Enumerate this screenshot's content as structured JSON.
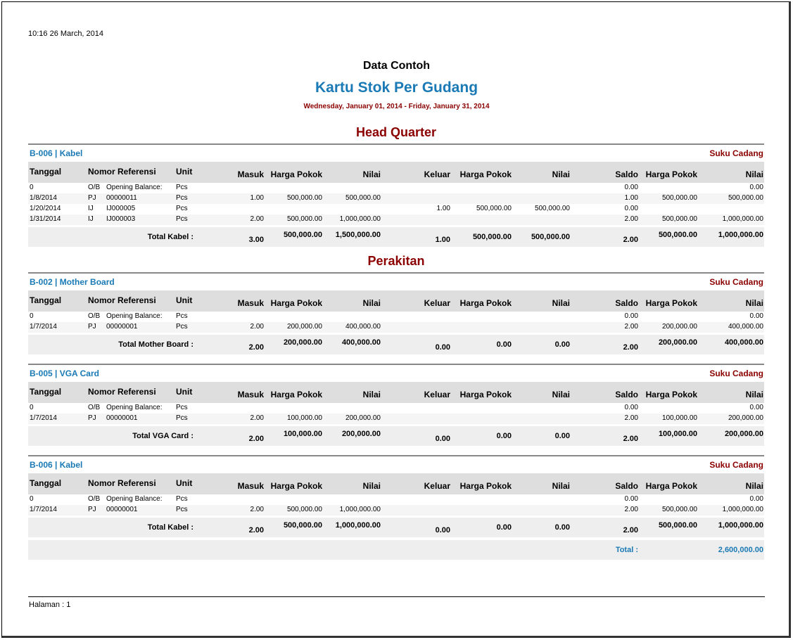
{
  "header": {
    "time": "10:16  26 March, 2014",
    "company": "Data Contoh",
    "title": "Kartu Stok Per Gudang",
    "period": "Wednesday, January 01, 2014 - Friday, January 31, 2014"
  },
  "columns": {
    "tanggal": "Tanggal",
    "nomor_referensi": "Nomor Referensi",
    "unit": "Unit",
    "masuk": "Masuk",
    "harga_pokok_masuk": "Harga Pokok",
    "nilai_masuk": "Nilai",
    "keluar": "Keluar",
    "harga_pokok_keluar": "Harga Pokok",
    "nilai_keluar": "Nilai",
    "saldo": "Saldo",
    "harga_pokok_saldo": "Harga Pokok",
    "nilai_saldo": "Nilai"
  },
  "warehouses": [
    {
      "name": "Head Quarter",
      "groups": [
        {
          "code": "B-006  |  Kabel",
          "category": "Suku Cadang",
          "rows": [
            [
              "0",
              "O/B",
              "Opening Balance:",
              "Pcs",
              "",
              "",
              "",
              "",
              "",
              "",
              "0.00",
              "",
              "0.00"
            ],
            [
              "1/8/2014",
              "PJ",
              "00000011",
              "Pcs",
              "1.00",
              "500,000.00",
              "500,000.00",
              "",
              "",
              "",
              "1.00",
              "500,000.00",
              "500,000.00"
            ],
            [
              "1/20/2014",
              "IJ",
              "IJ000005",
              "Pcs",
              "",
              "",
              "",
              "1.00",
              "500,000.00",
              "500,000.00",
              "0.00",
              "",
              ""
            ],
            [
              "1/31/2014",
              "IJ",
              "IJ000003",
              "Pcs",
              "2.00",
              "500,000.00",
              "1,000,000.00",
              "",
              "",
              "",
              "2.00",
              "500,000.00",
              "1,000,000.00"
            ]
          ],
          "total": [
            "Total Kabel :",
            "3.00",
            "500,000.00",
            "1,500,000.00",
            "1.00",
            "500,000.00",
            "500,000.00",
            "2.00",
            "500,000.00",
            "1,000,000.00"
          ]
        }
      ]
    },
    {
      "name": "Perakitan",
      "groups": [
        {
          "code": "B-002  |  Mother Board",
          "category": "Suku Cadang",
          "rows": [
            [
              "0",
              "O/B",
              "Opening Balance:",
              "Pcs",
              "",
              "",
              "",
              "",
              "",
              "",
              "0.00",
              "",
              "0.00"
            ],
            [
              "1/7/2014",
              "PJ",
              "00000001",
              "Pcs",
              "2.00",
              "200,000.00",
              "400,000.00",
              "",
              "",
              "",
              "2.00",
              "200,000.00",
              "400,000.00"
            ]
          ],
          "total": [
            "Total Mother Board :",
            "2.00",
            "200,000.00",
            "400,000.00",
            "0.00",
            "0.00",
            "0.00",
            "2.00",
            "200,000.00",
            "400,000.00"
          ]
        },
        {
          "code": "B-005  |  VGA Card",
          "category": "Suku Cadang",
          "rows": [
            [
              "0",
              "O/B",
              "Opening Balance:",
              "Pcs",
              "",
              "",
              "",
              "",
              "",
              "",
              "0.00",
              "",
              "0.00"
            ],
            [
              "1/7/2014",
              "PJ",
              "00000001",
              "Pcs",
              "2.00",
              "100,000.00",
              "200,000.00",
              "",
              "",
              "",
              "2.00",
              "100,000.00",
              "200,000.00"
            ]
          ],
          "total": [
            "Total VGA Card :",
            "2.00",
            "100,000.00",
            "200,000.00",
            "0.00",
            "0.00",
            "0.00",
            "2.00",
            "100,000.00",
            "200,000.00"
          ]
        },
        {
          "code": "B-006  |  Kabel",
          "category": "Suku Cadang",
          "rows": [
            [
              "0",
              "O/B",
              "Opening Balance:",
              "Pcs",
              "",
              "",
              "",
              "",
              "",
              "",
              "0.00",
              "",
              "0.00"
            ],
            [
              "1/7/2014",
              "PJ",
              "00000001",
              "Pcs",
              "2.00",
              "500,000.00",
              "1,000,000.00",
              "",
              "",
              "",
              "2.00",
              "500,000.00",
              "1,000,000.00"
            ]
          ],
          "total": [
            "Total Kabel :",
            "2.00",
            "500,000.00",
            "1,000,000.00",
            "0.00",
            "0.00",
            "0.00",
            "2.00",
            "500,000.00",
            "1,000,000.00"
          ]
        }
      ]
    }
  ],
  "grand_total": {
    "label": "Total :",
    "value": "2,600,000.00"
  },
  "footer": {
    "page": "Halaman : 1"
  },
  "colors": {
    "accent_blue": "#1a7ab5",
    "accent_red": "#8b0000"
  }
}
